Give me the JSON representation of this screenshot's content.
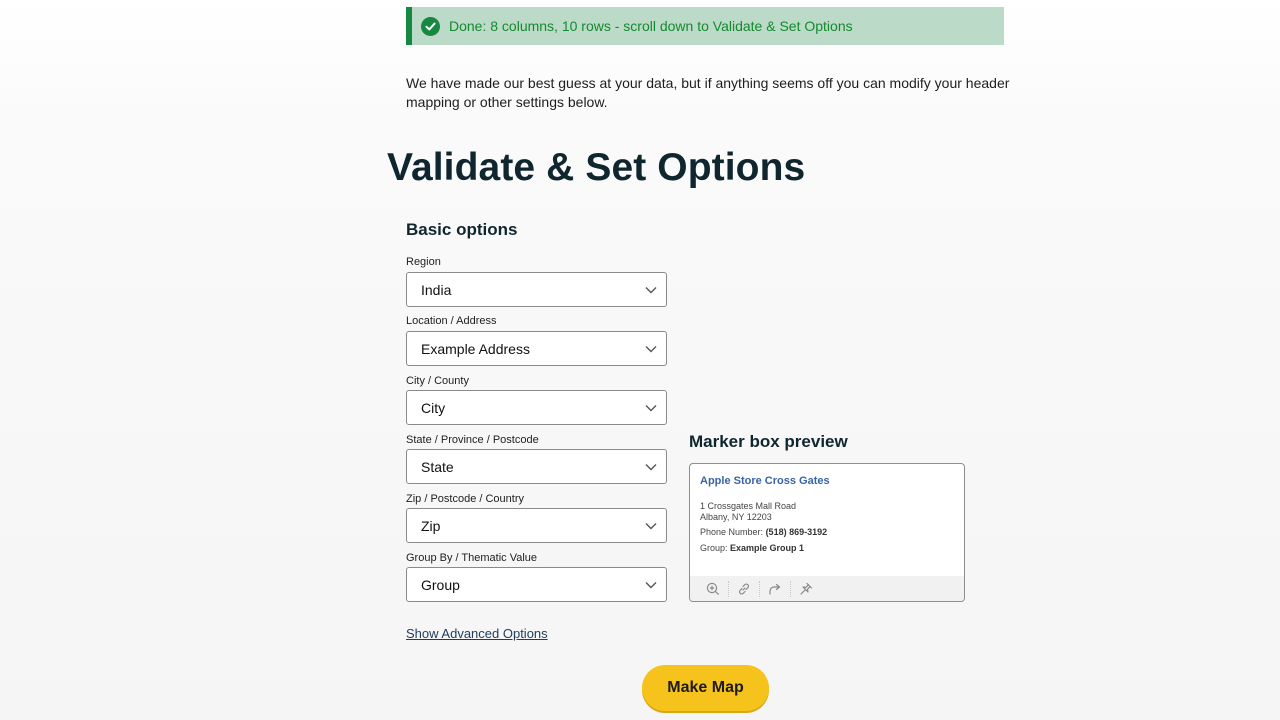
{
  "banner": {
    "message": "Done: 8 columns, 10 rows - scroll down to Validate & Set Options"
  },
  "intro_text": "We have made our best guess at your data, but if anything seems off you can modify your header mapping or other settings below.",
  "page_title": "Validate & Set Options",
  "basic_options": {
    "title": "Basic options",
    "fields": [
      {
        "label": "Region",
        "value": "India"
      },
      {
        "label": "Location / Address",
        "value": "Example Address"
      },
      {
        "label": "City / County",
        "value": "City"
      },
      {
        "label": "State / Province / Postcode",
        "value": "State"
      },
      {
        "label": "Zip / Postcode / Country",
        "value": "Zip"
      },
      {
        "label": "Group By / Thematic Value",
        "value": "Group"
      }
    ]
  },
  "preview": {
    "title": "Marker box preview",
    "place_name": "Apple Store Cross Gates",
    "address_line1": "1 Crossgates Mall Road",
    "address_line2": "Albany, NY 12203",
    "phone_label": "Phone Number:",
    "phone_value": "(518) 869-3192",
    "group_label": "Group:",
    "group_value": "Example Group 1",
    "tools": [
      "zoom-in-icon",
      "link-icon",
      "share-icon",
      "pin-icon"
    ]
  },
  "advanced_link": "Show Advanced Options",
  "make_map_label": "Make Map",
  "colors": {
    "banner_bg": "#bcdac8",
    "banner_accent": "#17883f",
    "button_yellow": "#f6c21c",
    "title_dark": "#10262f",
    "link_blue": "#3a63a8"
  }
}
